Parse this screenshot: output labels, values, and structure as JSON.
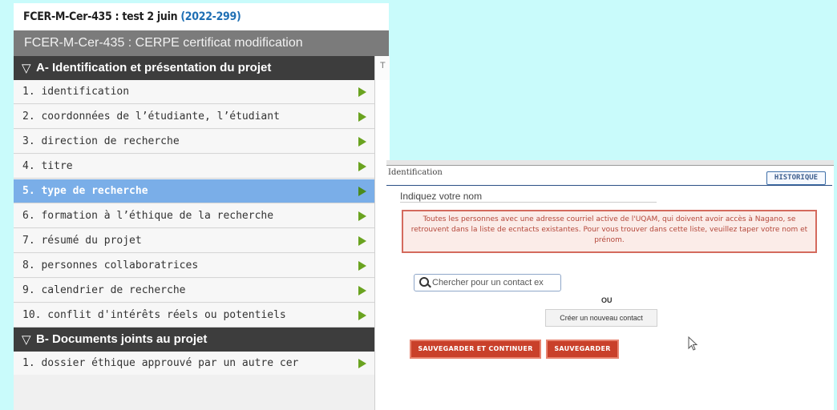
{
  "header": {
    "title_prefix": "FCER-M-Cer-435 : test 2 juin ",
    "title_id": "(2022-299)"
  },
  "form": {
    "title": "FCER-M-Cer-435 : CERPE certificat modification"
  },
  "sections": [
    {
      "label": "A- Identification et présentation du projet",
      "items": [
        "1. identification",
        "2. coordonnées de l’étudiante, l’étudiant",
        "3. direction de recherche",
        "4. titre",
        "5. type de recherche",
        "6. formation à l’éthique de la recherche",
        "7. résumé du projet",
        "8. personnes collaboratrices",
        "9. calendrier de recherche",
        "10. conflit d'intérêts réels ou potentiels"
      ],
      "active_index": 4
    },
    {
      "label": "B- Documents joints au projet",
      "items": [
        "1. dossier éthique approuvé par un autre cer"
      ]
    }
  ],
  "strip_glyph": "T",
  "panel": {
    "section_title": "Identification",
    "history_button": "HISTORIQUE",
    "prompt": "Indiquez votre nom",
    "notice": "Toutes les personnes avec une adresse courriel active de l'UQAM, qui doivent avoir accès à Nagano, se retrouvent dans la liste de ecntacts existantes. Pour vous trouver dans cette liste, veuillez taper votre nom et prénom.",
    "search_placeholder": "Chercher pour un contact ex",
    "or_label": "OU",
    "create_contact": "Créer un nouveau contact",
    "save_continue": "SAUVEGARDER ET CONTINUER",
    "save": "SAUVEGARDER"
  },
  "colors": {
    "background": "#c9fbfb",
    "active_item": "#7aaee8",
    "section_bar": "#3d3d3d",
    "arrow": "#6aa320",
    "primary_button": "#c9402a",
    "notice_border": "#d46a5d"
  }
}
